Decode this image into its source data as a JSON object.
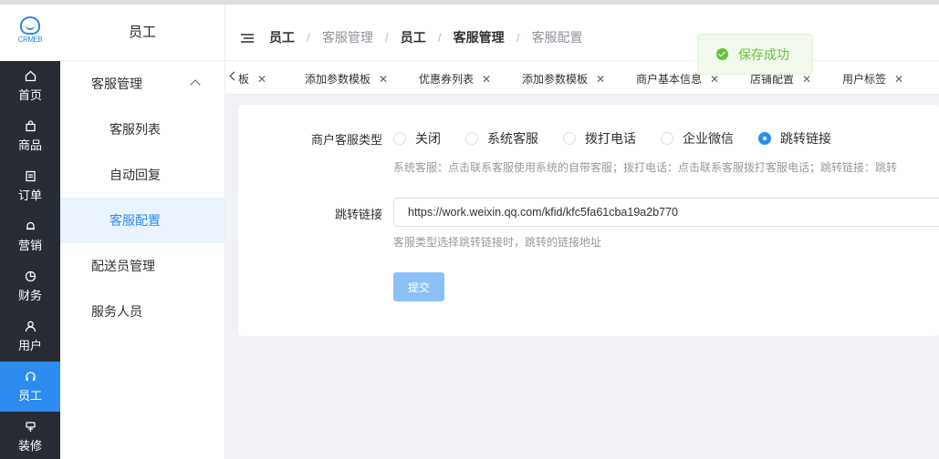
{
  "colors": {
    "primary": "#2d8cf0",
    "sidebar_bg": "#282c34",
    "success": "#67c23a"
  },
  "nav": {
    "items": [
      {
        "label": "首页",
        "icon": "home-icon"
      },
      {
        "label": "商品",
        "icon": "bag-icon"
      },
      {
        "label": "订单",
        "icon": "order-icon"
      },
      {
        "label": "营销",
        "icon": "bell-icon"
      },
      {
        "label": "财务",
        "icon": "pie-icon"
      },
      {
        "label": "用户",
        "icon": "user-icon"
      },
      {
        "label": "员工",
        "icon": "headset-icon",
        "active": true
      },
      {
        "label": "装修",
        "icon": "brush-icon"
      }
    ]
  },
  "subnav": {
    "title": "员工",
    "items": [
      {
        "label": "客服管理"
      },
      {
        "label": "客服列表"
      },
      {
        "label": "自动回复"
      },
      {
        "label": "客服配置"
      },
      {
        "label": "配送员管理"
      },
      {
        "label": "服务人员"
      }
    ]
  },
  "breadcrumb": [
    "员工",
    "客服管理",
    "员工",
    "客服管理",
    "客服配置"
  ],
  "tabs": [
    {
      "label": "板"
    },
    {
      "label": "添加参数模板"
    },
    {
      "label": "优惠券列表"
    },
    {
      "label": "添加参数模板"
    },
    {
      "label": "商户基本信息"
    },
    {
      "label": "店铺配置"
    },
    {
      "label": "用户标签"
    }
  ],
  "form": {
    "type_label": "商户客服类型",
    "options": [
      "关闭",
      "系统客服",
      "拨打电话",
      "企业微信",
      "跳转链接"
    ],
    "selected_option": "跳转链接",
    "type_hint": "系统客服：点击联系客服使用系统的自带客服；拨打电话：点击联系客服拨打客服电话；跳转链接：跳转",
    "link_label": "跳转链接",
    "link_value": "https://work.weixin.qq.com/kfid/kfc5fa61cba19a2b770",
    "link_hint": "客服类型选择跳转链接时，跳转的链接地址",
    "submit_label": "提交"
  },
  "toast": {
    "text": "保存成功"
  }
}
